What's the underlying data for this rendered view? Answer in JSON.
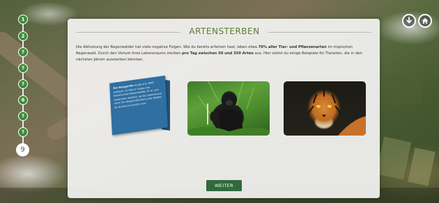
{
  "nav": {
    "steps": [
      "1",
      "2",
      "?",
      "?",
      "?",
      "6",
      "?",
      "?",
      "?"
    ],
    "current": "9"
  },
  "header_buttons": {
    "download_icon": "download-icon",
    "home_icon": "home-icon"
  },
  "panel": {
    "title": "ARTENSTERBEN",
    "intro": {
      "p1": "Die Abholzung der Regenwälder hat viele negative Folgen. Wie du bereits erfahren hast, leben etwa ",
      "b1": "70% aller Tier- und Pflanzenarten",
      "p2": " im tropischen Regenwald. Durch den Verlust ihres Lebensraums sterben ",
      "b2": "pro Tag zwischen 50 und 350 Arten",
      "p3": " aus. Hier siehst du einige Beispiele für Tierarten, die in den nächsten Jahren aussterben könnten."
    },
    "card": {
      "bold": "Der Berggorilla",
      "text": " wurde erst 1999 entdeckt. Er lebt im Süden des kenianischen Regenwaldes. Er ist vom Aussterben bedroht, da der Lebensraum durch die illegale Abholzung des Waldes als Ackerland zerstört wird."
    },
    "photos": [
      {
        "name": "gorilla",
        "icon": "gorilla-photo"
      },
      {
        "name": "tiger",
        "icon": "tiger-photo"
      }
    ],
    "button_label": "WEITER"
  }
}
